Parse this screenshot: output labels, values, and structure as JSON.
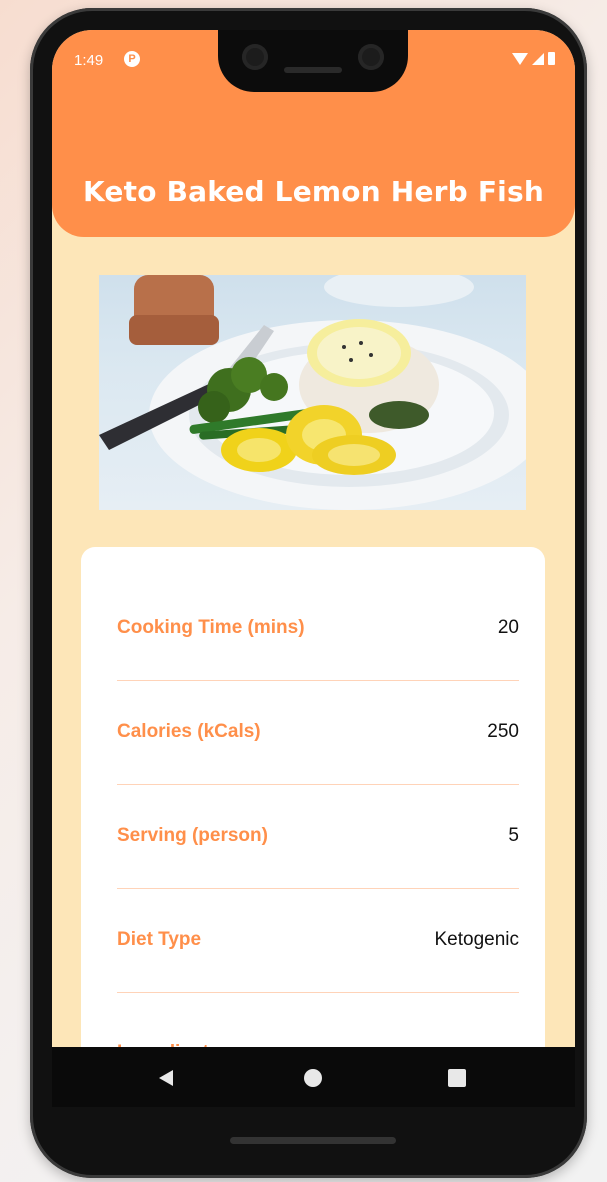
{
  "status_bar": {
    "time": "1:49",
    "notification_icon": "p-circle-icon",
    "icons": [
      "wifi-icon",
      "signal-icon",
      "battery-icon"
    ]
  },
  "header": {
    "title": "Keto Baked Lemon Herb Fish"
  },
  "image": {
    "subject": "food-photo-icon"
  },
  "details": [
    {
      "label": "Cooking Time (mins)",
      "value": "20"
    },
    {
      "label": "Calories (kCals)",
      "value": "250"
    },
    {
      "label": "Serving (person)",
      "value": "5"
    },
    {
      "label": "Diet Type",
      "value": "Ketogenic"
    },
    {
      "label": "Ingredients",
      "value": ""
    }
  ],
  "nav": {
    "icons": [
      "back-icon",
      "home-icon",
      "recent-apps-icon"
    ]
  },
  "colors": {
    "accent": "#ff8f4a",
    "background": "#fde6b8",
    "card": "#ffffff"
  }
}
